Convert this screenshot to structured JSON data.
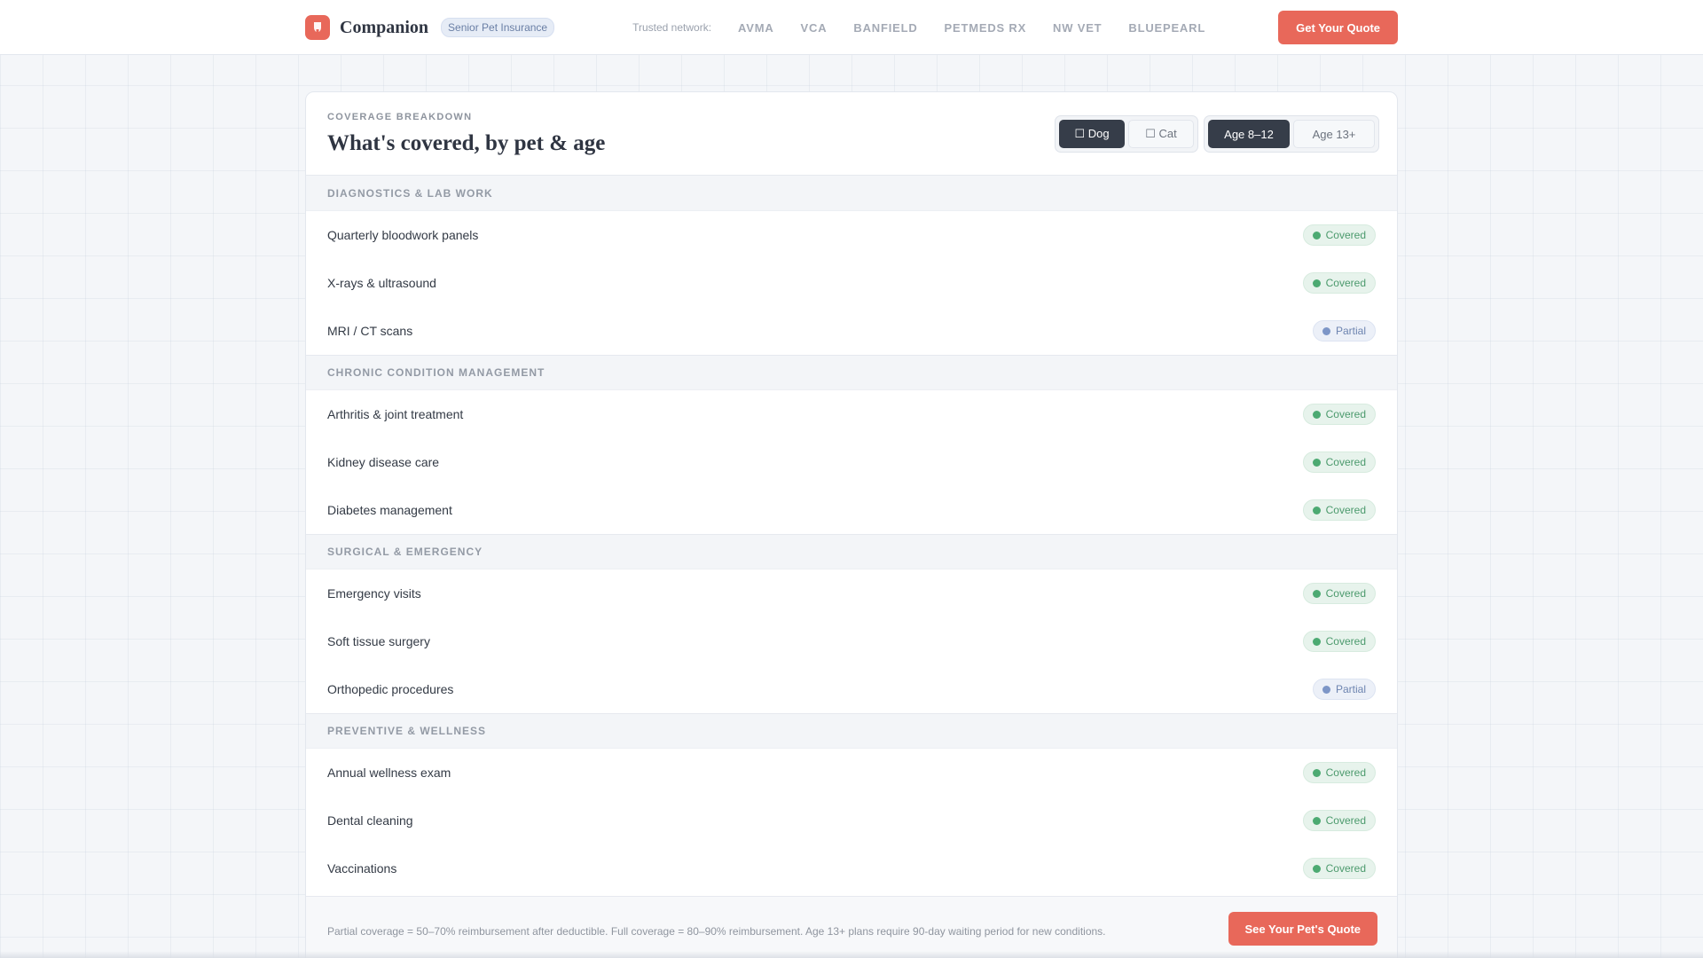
{
  "header": {
    "brand": "Companion",
    "badge": "Senior Pet Insurance",
    "network_label": "Trusted network:",
    "network": [
      "AVMA",
      "VCA",
      "BANFIELD",
      "PETMEDS RX",
      "NW VET",
      "BLUEPEARL"
    ],
    "cta": "Get Your Quote"
  },
  "card": {
    "eyebrow": "COVERAGE BREAKDOWN",
    "title": "What's covered, by pet & age",
    "pet_toggle": [
      "☐ Dog",
      "☐ Cat"
    ],
    "pet_selected": "☐ Dog",
    "age_toggle": [
      "Age 8–12",
      "Age 13+"
    ],
    "age_selected": "Age 8–12"
  },
  "sections": [
    {
      "title": "DIAGNOSTICS & LAB WORK",
      "items": [
        {
          "label": "Quarterly bloodwork panels",
          "status": "Covered"
        },
        {
          "label": "X-rays & ultrasound",
          "status": "Covered"
        },
        {
          "label": "MRI / CT scans",
          "status": "Partial"
        }
      ]
    },
    {
      "title": "CHRONIC CONDITION MANAGEMENT",
      "items": [
        {
          "label": "Arthritis & joint treatment",
          "status": "Covered"
        },
        {
          "label": "Kidney disease care",
          "status": "Covered"
        },
        {
          "label": "Diabetes management",
          "status": "Covered"
        }
      ]
    },
    {
      "title": "SURGICAL & EMERGENCY",
      "items": [
        {
          "label": "Emergency visits",
          "status": "Covered"
        },
        {
          "label": "Soft tissue surgery",
          "status": "Covered"
        },
        {
          "label": "Orthopedic procedures",
          "status": "Partial"
        }
      ]
    },
    {
      "title": "PREVENTIVE & WELLNESS",
      "items": [
        {
          "label": "Annual wellness exam",
          "status": "Covered"
        },
        {
          "label": "Dental cleaning",
          "status": "Covered"
        },
        {
          "label": "Vaccinations",
          "status": "Covered"
        }
      ]
    }
  ],
  "footer": {
    "note": "Partial coverage = 50–70% reimbursement after deductible. Full coverage = 80–90% reimbursement. Age 13+ plans require 90-day waiting period for new conditions.",
    "cta": "See Your Pet's Quote"
  },
  "colors": {
    "accent": "#e8685a",
    "dark": "#363d49",
    "covered": "#4caa72",
    "partial": "#7d96c7"
  },
  "icons": {
    "logo": "paw-shield-icon",
    "covered": "check-dot-icon",
    "partial": "half-dot-icon"
  }
}
